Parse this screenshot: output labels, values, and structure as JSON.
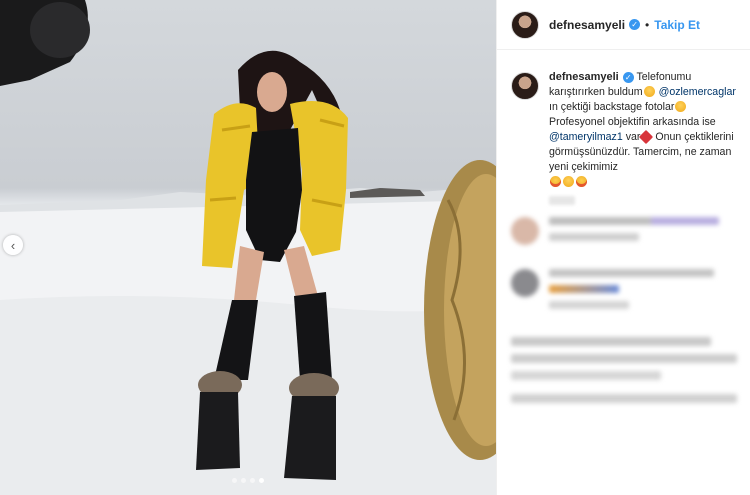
{
  "post": {
    "username": "defnesamyeli",
    "follow_label": "Takip Et",
    "separator": "•",
    "verified_glyph": "✓",
    "nav_prev_glyph": "‹",
    "caption": {
      "p1": "Telefonumu karıştırırken buldum",
      "mention1": "@ozlemercaglar",
      "p2": " ın çektiği backstage fotolar",
      "p3": " Profesyonel objektifin arkasında ise ",
      "mention2": "@tameryilmaz1",
      "p4": " var",
      "p5": " Onun çektiklerini görmüşsünüzdür. Tamercim, ne zaman yeni çekimimiz"
    },
    "carousel": {
      "count": 4,
      "active_index": 3
    }
  },
  "colors": {
    "accent": "#3897f0",
    "jacket": "#e9c42a",
    "mention": "#003569"
  },
  "icons": [
    "verified-badge-icon",
    "chevron-left-icon"
  ]
}
